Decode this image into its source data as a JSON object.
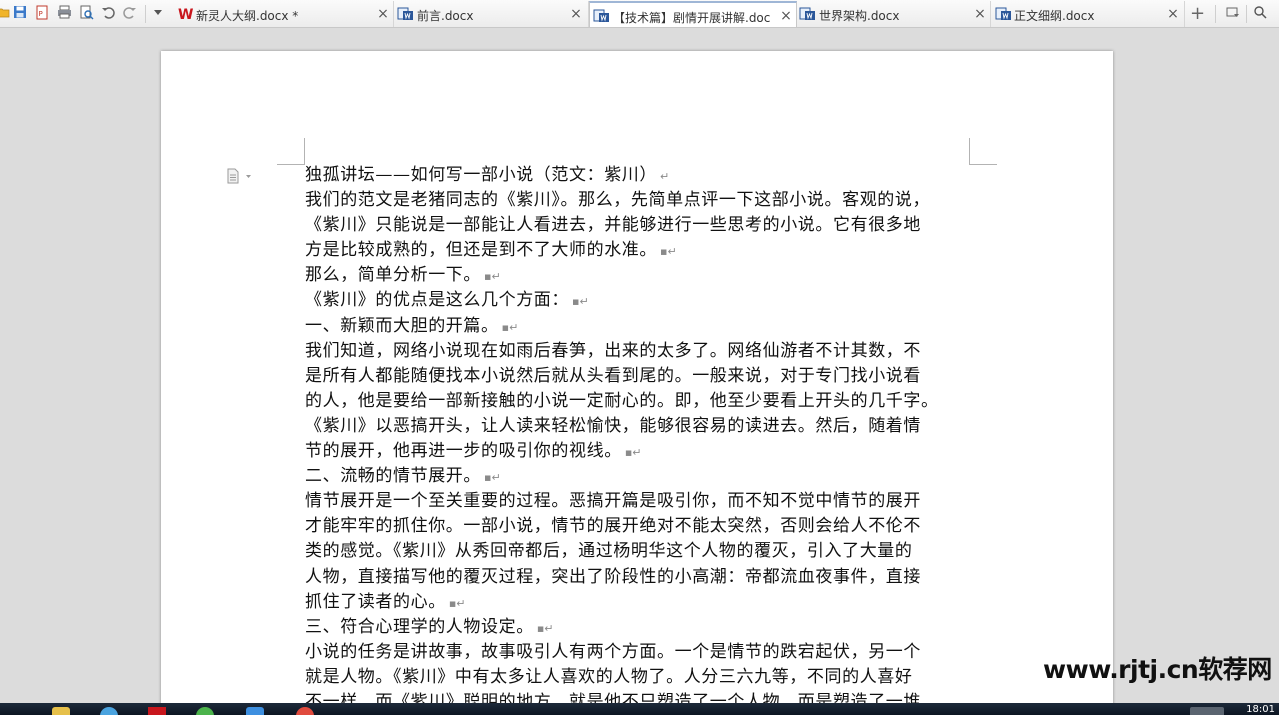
{
  "toolbar": {
    "icons": [
      "open-folder-icon",
      "save-icon",
      "export-pdf-icon",
      "print-icon",
      "print-preview-icon",
      "undo-icon",
      "redo-icon",
      "customize-dropdown-icon"
    ],
    "right_icons": [
      "new-tab-plus-icon",
      "tab-list-icon",
      "search-icon"
    ]
  },
  "tabs": [
    {
      "label": "新灵人大纲.docx *",
      "icon": "wps-writer-logo-icon",
      "active": false
    },
    {
      "label": "前言.docx",
      "icon": "docx-file-icon",
      "active": false
    },
    {
      "label": "【技术篇】剧情开展讲解.doc",
      "icon": "docx-file-icon",
      "active": true
    },
    {
      "label": "世界架构.docx",
      "icon": "docx-file-icon",
      "active": false
    },
    {
      "label": "正文细纲.docx",
      "icon": "docx-file-icon",
      "active": false
    }
  ],
  "document": {
    "para_mark": "↵",
    "lines": [
      {
        "text": "独孤讲坛——如何写一部小说（范文：紫川）",
        "mark": "↵"
      },
      {
        "text": "我们的范文是老猪同志的《紫川》。那么，先简单点评一下这部小说。客观的说，",
        "mark": ""
      },
      {
        "text": "《紫川》只能说是一部能让人看进去，并能够进行一些思考的小说。它有很多地",
        "mark": ""
      },
      {
        "text": "方是比较成熟的，但还是到不了大师的水准。",
        "mark": "▪↵"
      },
      {
        "text": "那么，简单分析一下。",
        "mark": "▪↵"
      },
      {
        "text": "《紫川》的优点是这么几个方面：",
        "mark": "▪↵"
      },
      {
        "text": "一、新颖而大胆的开篇。",
        "mark": "▪↵"
      },
      {
        "text": "我们知道，网络小说现在如雨后春笋，出来的太多了。网络仙游者不计其数，不",
        "mark": ""
      },
      {
        "text": "是所有人都能随便找本小说然后就从头看到尾的。一般来说，对于专门找小说看",
        "mark": ""
      },
      {
        "text": "的人，他是要给一部新接触的小说一定耐心的。即，他至少要看上开头的几千字。",
        "mark": ""
      },
      {
        "text": "《紫川》以恶搞开头，让人读来轻松愉快，能够很容易的读进去。然后，随着情",
        "mark": ""
      },
      {
        "text": "节的展开，他再进一步的吸引你的视线。",
        "mark": "▪↵"
      },
      {
        "text": "二、流畅的情节展开。",
        "mark": "▪↵"
      },
      {
        "text": "情节展开是一个至关重要的过程。恶搞开篇是吸引你，而不知不觉中情节的展开",
        "mark": ""
      },
      {
        "text": "才能牢牢的抓住你。一部小说，情节的展开绝对不能太突然，否则会给人不伦不",
        "mark": ""
      },
      {
        "text": "类的感觉。《紫川》从秀回帝都后，通过杨明华这个人物的覆灭，引入了大量的",
        "mark": ""
      },
      {
        "text": "人物，直接描写他的覆灭过程，突出了阶段性的小高潮：帝都流血夜事件，直接",
        "mark": ""
      },
      {
        "text": "抓住了读者的心。",
        "mark": "▪↵"
      },
      {
        "text": "三、符合心理学的人物设定。",
        "mark": "▪↵"
      },
      {
        "text": "小说的任务是讲故事，故事吸引人有两个方面。一个是情节的跌宕起伏，另一个",
        "mark": ""
      },
      {
        "text": "就是人物。《紫川》中有太多让人喜欢的人物了。人分三六九等，不同的人喜好",
        "mark": ""
      },
      {
        "text": "不一样。而《紫川》聪明的地方，就是他不只塑造了一个人物，而是塑造了一堆",
        "mark": ""
      }
    ]
  },
  "watermark": "www.rjtj.cn软荐网",
  "taskbar": {
    "clock": "18:01",
    "icons": [
      "file-explorer-icon",
      "browser-icon",
      "wps-icon",
      "app-green-icon",
      "app-blue-icon",
      "chrome-icon"
    ]
  },
  "colors": {
    "active_tab_border": "#9fb6d6",
    "wps_red": "#c8161d",
    "page_bg": "#ffffff",
    "workspace_bg": "#dcdcdc"
  }
}
